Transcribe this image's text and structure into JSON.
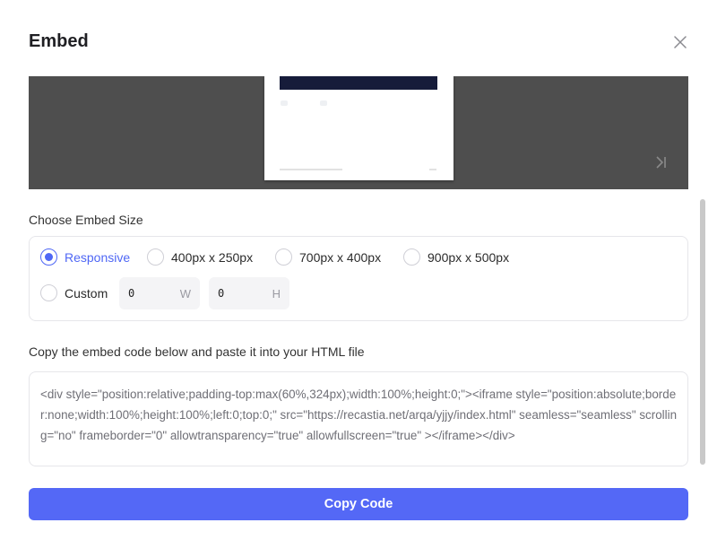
{
  "modal": {
    "title": "Embed",
    "close_icon": "close-icon"
  },
  "preview": {
    "last_page_icon": "skip-to-last-icon"
  },
  "size": {
    "label": "Choose Embed Size",
    "options": [
      {
        "label": "Responsive",
        "selected": true
      },
      {
        "label": "400px x 250px",
        "selected": false
      },
      {
        "label": "700px x 400px",
        "selected": false
      },
      {
        "label": "900px x 500px",
        "selected": false
      },
      {
        "label": "Custom",
        "selected": false
      }
    ],
    "custom": {
      "width_value": "0",
      "width_unit": "W",
      "height_value": "0",
      "height_unit": "H"
    }
  },
  "code": {
    "label": "Copy the embed code below and paste it into your HTML file",
    "text": "<div style=\"position:relative;padding-top:max(60%,324px);width:100%;height:0;\"><iframe style=\"position:absolute;border:none;width:100%;height:100%;left:0;top:0;\" src=\"https://recastia.net/arqa/yjjy/index.html\" seamless=\"seamless\" scrolling=\"no\" frameborder=\"0\" allowtransparency=\"true\" allowfullscreen=\"true\" ></iframe></div>"
  },
  "copy_button": {
    "label": "Copy Code"
  },
  "colors": {
    "accent": "#5468f6",
    "preview_bg": "#4e4e4e",
    "banner": "#161c3a"
  }
}
